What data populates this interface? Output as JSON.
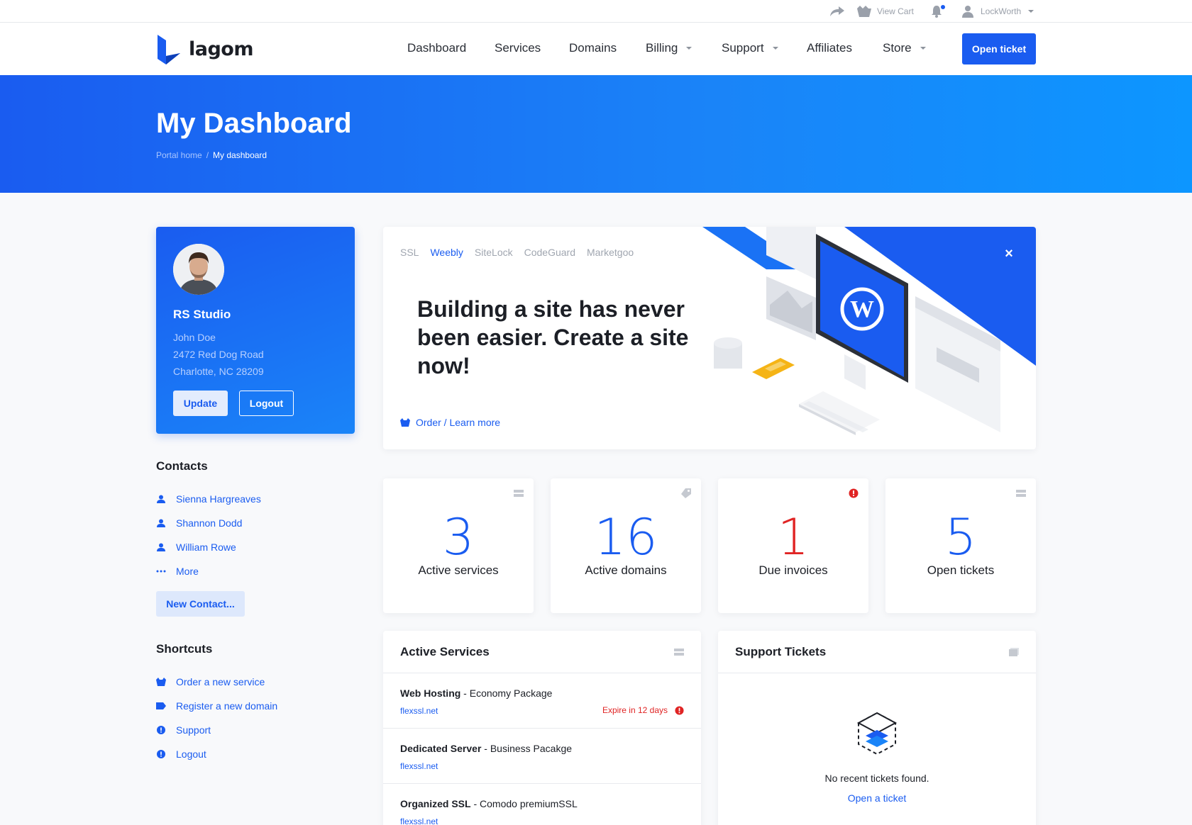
{
  "topbar": {
    "cart_label": "View Cart",
    "user_label": "LockWorth"
  },
  "brand": {
    "name": "lagom"
  },
  "nav": {
    "items": [
      {
        "label": "Dashboard"
      },
      {
        "label": "Services"
      },
      {
        "label": "Domains"
      },
      {
        "label": "Billing"
      },
      {
        "label": "Support"
      },
      {
        "label": "Affiliates"
      },
      {
        "label": "Store"
      }
    ],
    "cta_label": "Open ticket"
  },
  "hero": {
    "title": "My Dashboard",
    "breadcrumb": [
      "Portal home",
      "/",
      "My dashboard"
    ]
  },
  "profile": {
    "company": "RS Studio",
    "name": "John Doe",
    "address1": "2472 Red Dog Road",
    "address2": "Charlotte, NC 28209",
    "update_label": "Update",
    "logout_label": "Logout"
  },
  "contacts": {
    "title": "Contacts",
    "items": [
      "Sienna Hargreaves",
      "Shannon Dodd",
      "William Rowe"
    ],
    "more_label": "More",
    "new_label": "New Contact..."
  },
  "shortcuts": {
    "title": "Shortcuts",
    "items": [
      {
        "label": "Order a new service",
        "icon": "basket-icon"
      },
      {
        "label": "Register a new domain",
        "icon": "tag-icon"
      },
      {
        "label": "Support",
        "icon": "alert-circle-icon"
      },
      {
        "label": "Logout",
        "icon": "alert-circle-icon"
      }
    ]
  },
  "promo": {
    "tabs": [
      "SSL",
      "Weebly",
      "SiteLock",
      "CodeGuard",
      "Marketgoo"
    ],
    "active_tab": "Weebly",
    "headline": "Building a site has never been easier. Create a site now!",
    "link_label": "Order / Learn more",
    "close_label": "×"
  },
  "stats": [
    {
      "value": "3",
      "label": "Active services",
      "color": "#1a5cf0",
      "icon": "server-icon"
    },
    {
      "value": "16",
      "label": "Active domains",
      "color": "#1a5cf0",
      "icon": "tag-icon"
    },
    {
      "value": "1",
      "label": "Due invoices",
      "color": "#e02424",
      "icon": "alert-icon"
    },
    {
      "value": "5",
      "label": "Open tickets",
      "color": "#1a5cf0",
      "icon": "server-icon"
    }
  ],
  "active_services": {
    "title": "Active Services",
    "rows": [
      {
        "product": "Web Hosting",
        "plan": " - Economy Package",
        "domain": "flexssl.net",
        "status": "Expire in 12 days"
      },
      {
        "product": "Dedicated Server",
        "plan": " - Business Pacakge",
        "domain": "flexssl.net",
        "status": ""
      },
      {
        "product": "Organized SSL",
        "plan": " - Comodo premiumSSL",
        "domain": "flexssl.net",
        "status": ""
      }
    ]
  },
  "support_tickets": {
    "title": "Support Tickets",
    "empty_text": "No recent tickets found.",
    "open_label": "Open a ticket"
  },
  "colors": {
    "primary": "#1a5cf0",
    "danger": "#e02424"
  }
}
